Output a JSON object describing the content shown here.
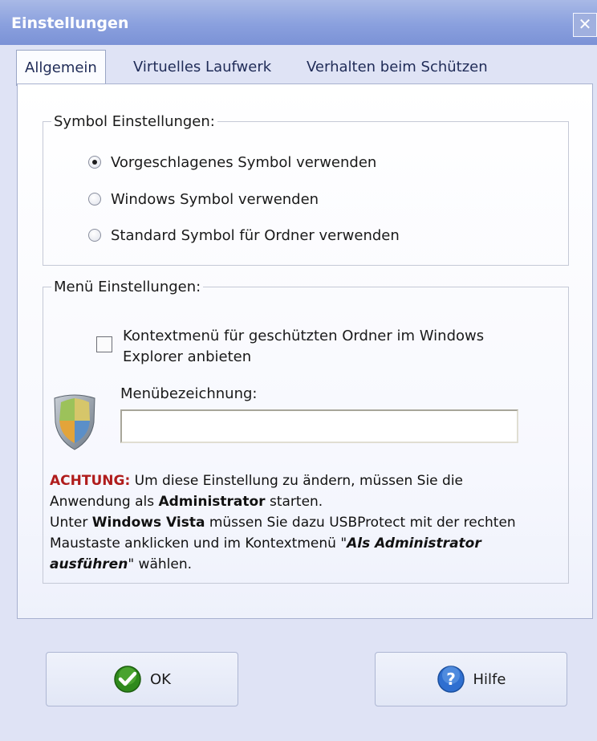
{
  "window": {
    "title": "Einstellungen",
    "close_glyph": "✕"
  },
  "tabs": [
    {
      "label": "Allgemein",
      "active": true
    },
    {
      "label": "Virtuelles Laufwerk",
      "active": false
    },
    {
      "label": "Verhalten beim Schützen",
      "active": false
    }
  ],
  "symbol_group": {
    "legend": "Symbol Einstellungen:",
    "options": [
      {
        "label": "Vorgeschlagenes Symbol verwenden",
        "checked": true
      },
      {
        "label": "Windows Symbol verwenden",
        "checked": false
      },
      {
        "label": "Standard Symbol für Ordner verwenden",
        "checked": false
      }
    ]
  },
  "menu_group": {
    "legend": "Menü Einstellungen:",
    "context_menu_label": "Kontextmenü für geschützten Ordner im Windows Explorer anbieten",
    "context_menu_checked": false,
    "menu_name_label": "Menübezeichnung:",
    "menu_name_value": "",
    "shield_icon": "shield-icon",
    "warning": {
      "label": "ACHTUNG:",
      "text1": " Um diese Einstellung zu ändern, müssen Sie die Anwendung als ",
      "bold1": "Administrator",
      "text2": " starten.",
      "text3": "Unter ",
      "bold2": "Windows Vista",
      "text4": " müssen Sie dazu USBProtect mit der rechten Maustaste anklicken und im Kontextmenü \"",
      "bold_italic": "Als Administrator ausführen",
      "text5": "\" wählen."
    }
  },
  "buttons": {
    "ok_label": "OK",
    "help_label": "Hilfe",
    "ok_icon": "check-icon",
    "help_icon": "help-icon"
  },
  "colors": {
    "titlebar": "#8aa0de",
    "warning": "#b01c1c",
    "ok_icon": "#2f8a1c",
    "help_icon": "#2f6fd0"
  }
}
